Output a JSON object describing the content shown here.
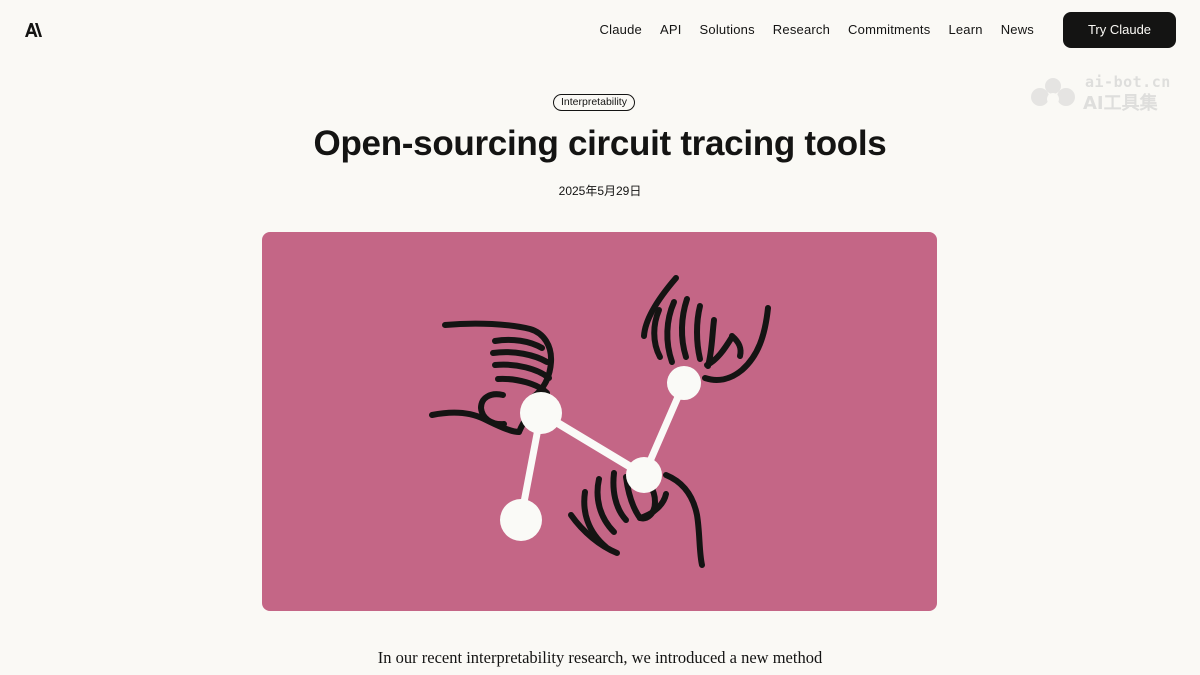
{
  "header": {
    "logo_text": "A\\",
    "nav": [
      "Claude",
      "API",
      "Solutions",
      "Research",
      "Commitments",
      "Learn",
      "News"
    ],
    "cta_label": "Try Claude"
  },
  "watermark": {
    "line1": "ai-bot.cn",
    "line2": "AI工具集"
  },
  "article": {
    "tag": "Interpretability",
    "title": "Open-sourcing circuit tracing tools",
    "date": "2025年5月29日",
    "lead": "In our recent interpretability research, we introduced a new method"
  },
  "colors": {
    "background": "#faf9f5",
    "hero": "#c46686",
    "ink": "#141413"
  },
  "icons": {
    "logo": "anthropic-logo-icon",
    "watermark": "ai-bot-logo-icon"
  }
}
